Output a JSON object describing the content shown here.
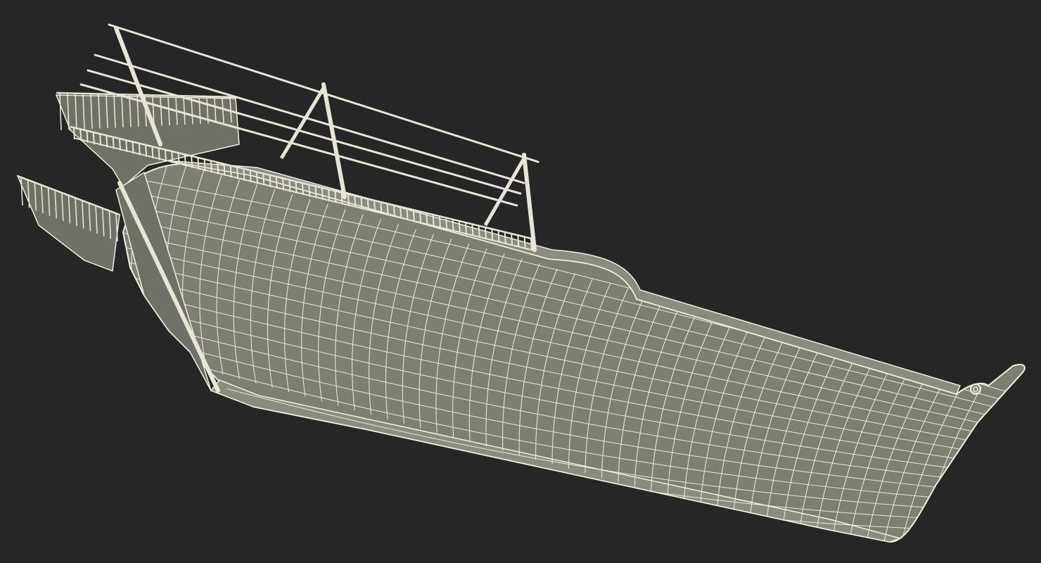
{
  "scene": {
    "subject": "wireframe-ship-hull-render",
    "colors": {
      "background": "#262626",
      "hull_fill": "#7d7f72",
      "hull_fill_dark": "#6f7166",
      "wire": "#f2efe2",
      "deck_fill": "#8a8c80",
      "rail": "#e8e5d6"
    }
  }
}
